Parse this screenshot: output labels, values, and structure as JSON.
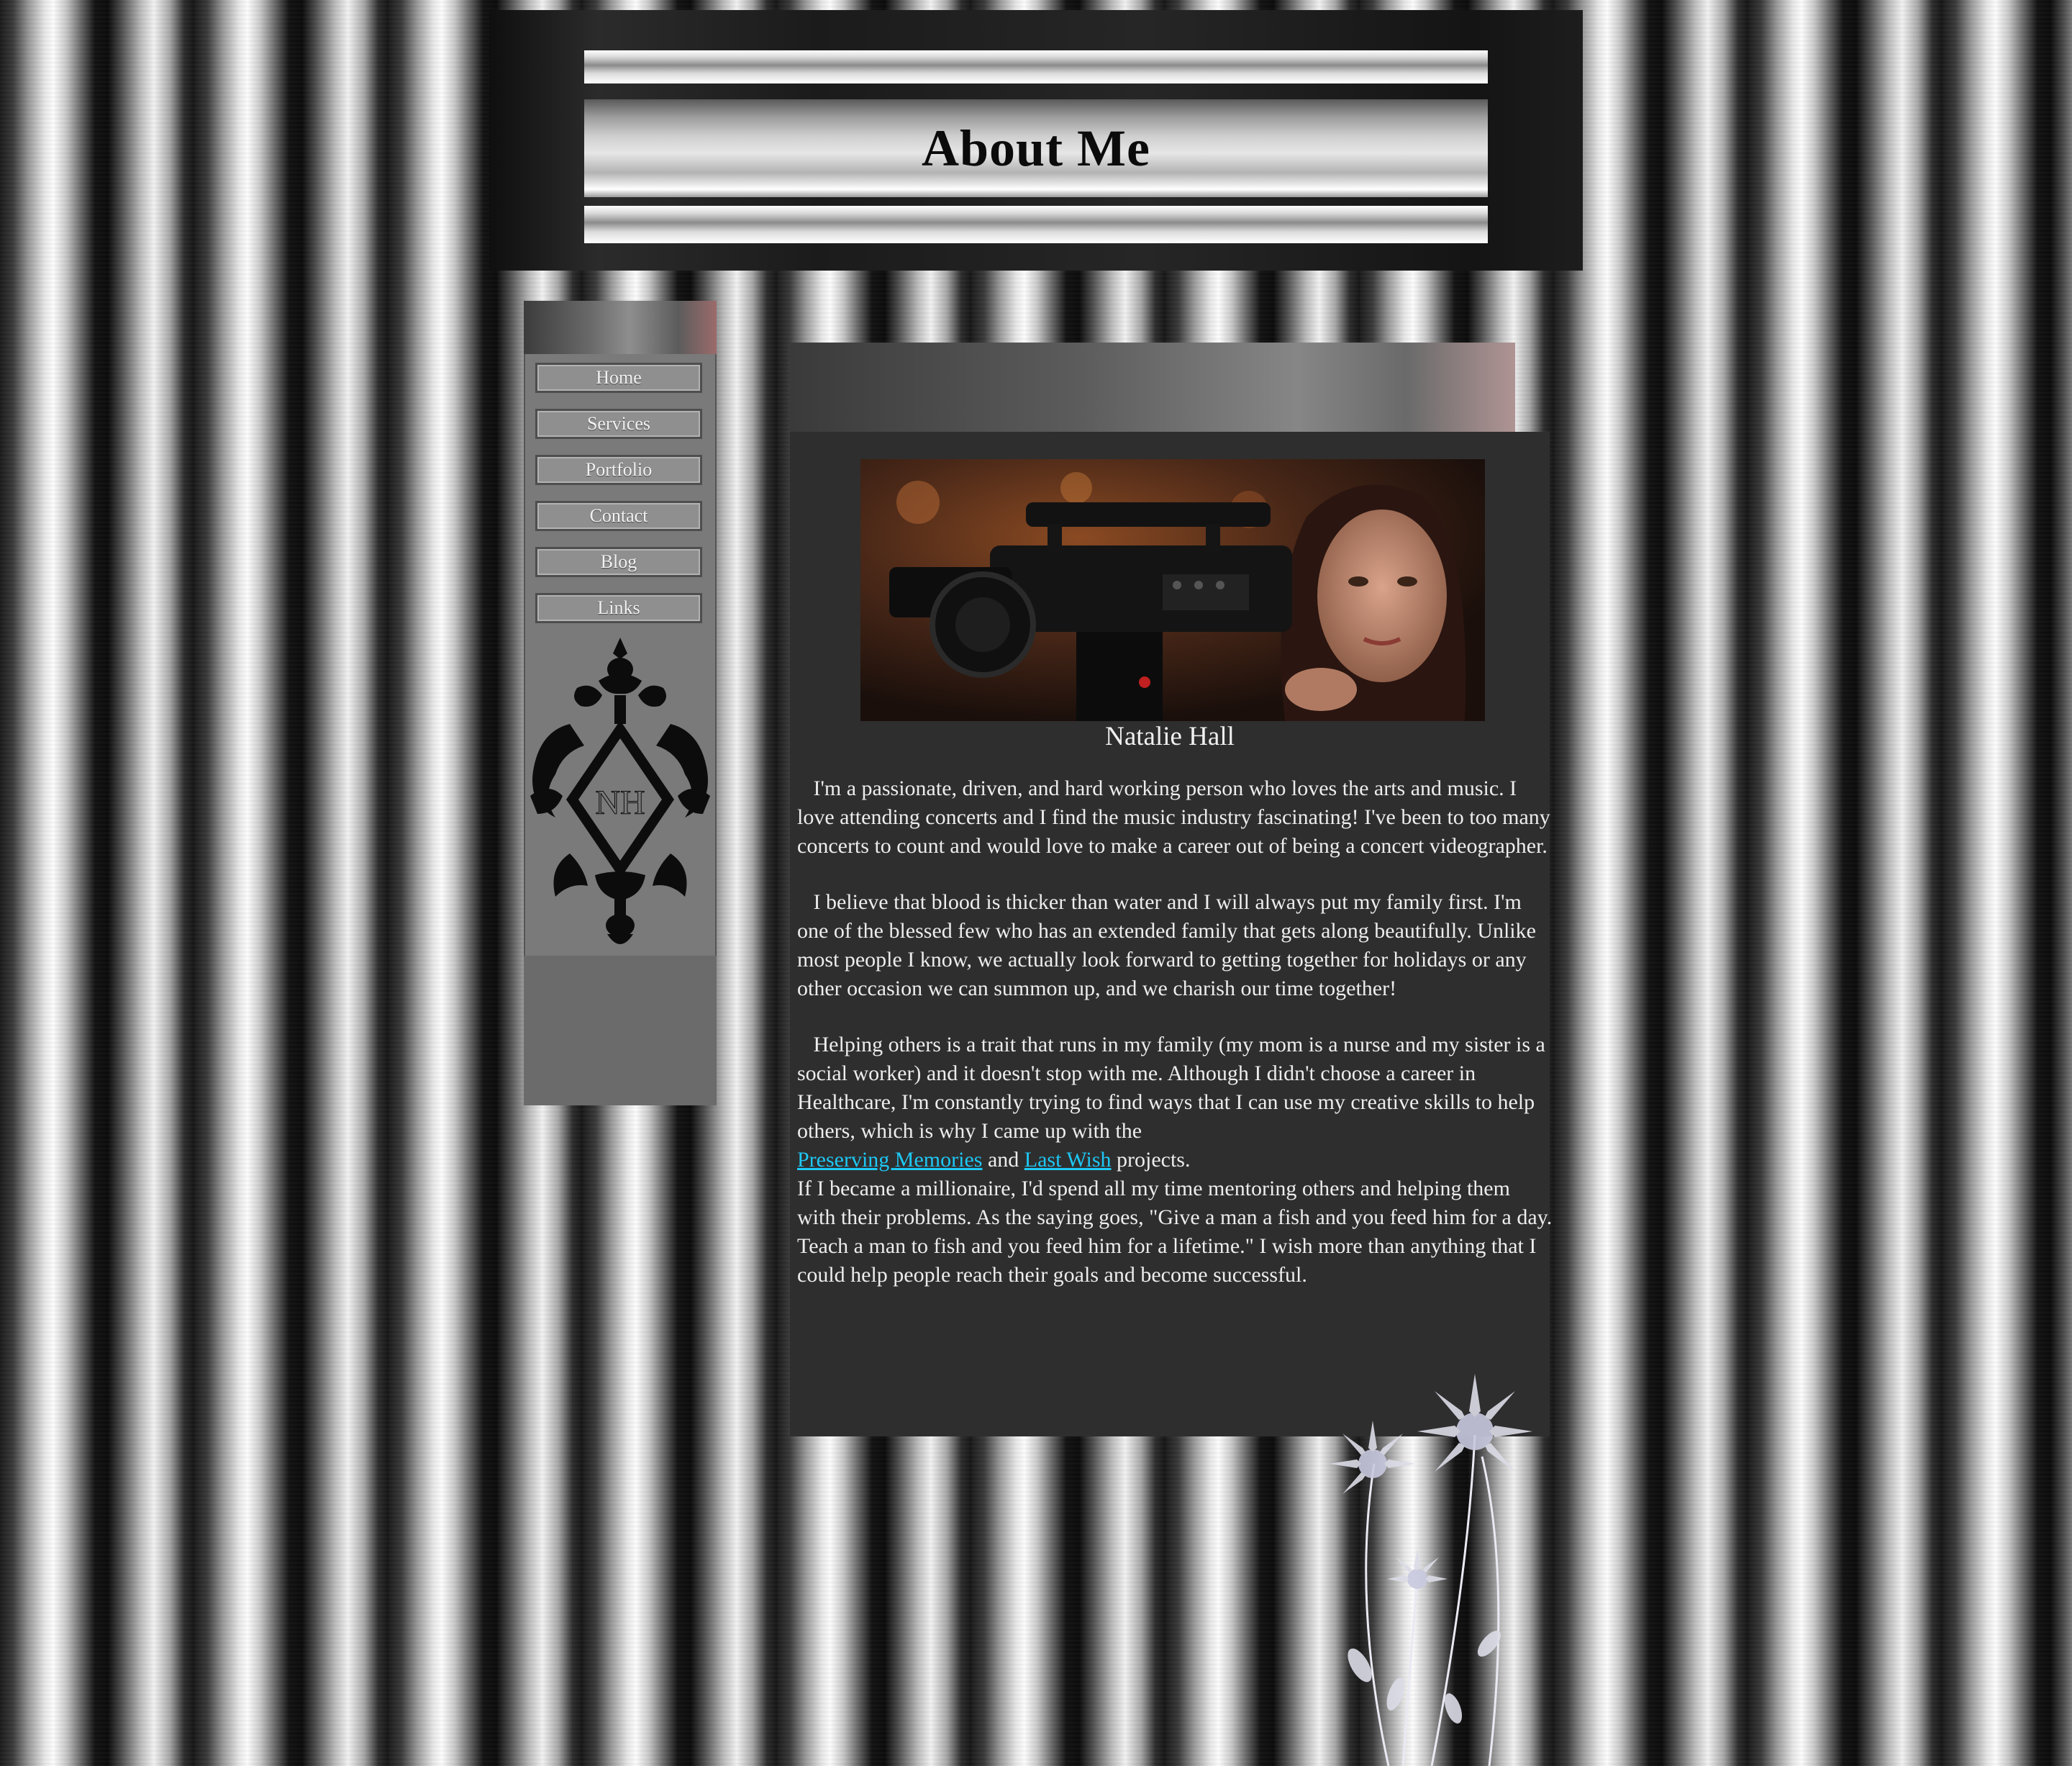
{
  "header": {
    "title": "About Me"
  },
  "sidebar": {
    "nav": [
      {
        "label": "Home"
      },
      {
        "label": "Services"
      },
      {
        "label": "Portfolio"
      },
      {
        "label": "Contact"
      },
      {
        "label": "Blog"
      },
      {
        "label": "Links"
      }
    ],
    "monogram_text": "NH"
  },
  "main": {
    "name": "Natalie Hall",
    "paragraph1": "I'm a passionate, driven, and hard working person who loves the arts and music. I love attending concerts and I find the music industry fascinating! I've been to too many concerts to count and would love to make a career out of being a concert videographer.",
    "paragraph2": "I believe that blood is thicker than water and I will always put my family first. I'm one of the blessed few who has an extended family that gets along beautifully. Unlike most people I know, we actually look forward to getting together for holidays or any other occasion we can summon up, and we charish our time together!",
    "paragraph3_before": "Helping others is a trait that runs in my family (my mom is a nurse and my sister is a social worker) and it doesn't stop with me. Although I didn't choose a career in Healthcare, I'm constantly trying to find ways that I can use my creative skills to help others, which is why I came up with the",
    "link1": "Preserving Memories",
    "and_text": "and",
    "link2": "Last Wish",
    "projects_text": "projects.",
    "paragraph4": "If I became a millionaire, I'd spend all my time mentoring others and helping them with their problems. As the saying goes, \"Give a man a fish and you feed him for a day. Teach a man to fish and you feed him for a lifetime.\" I wish more than anything that I could help people reach their goals and become successful."
  },
  "colors": {
    "link": "#1ec8f5",
    "content_bg": "#2e2e2e",
    "sidebar_bg": "#7a7a7a"
  },
  "icons": {
    "monogram": "damask-monogram-icon",
    "flowers": "flower-decoration-icon",
    "photo": "camera-woman-photo"
  }
}
